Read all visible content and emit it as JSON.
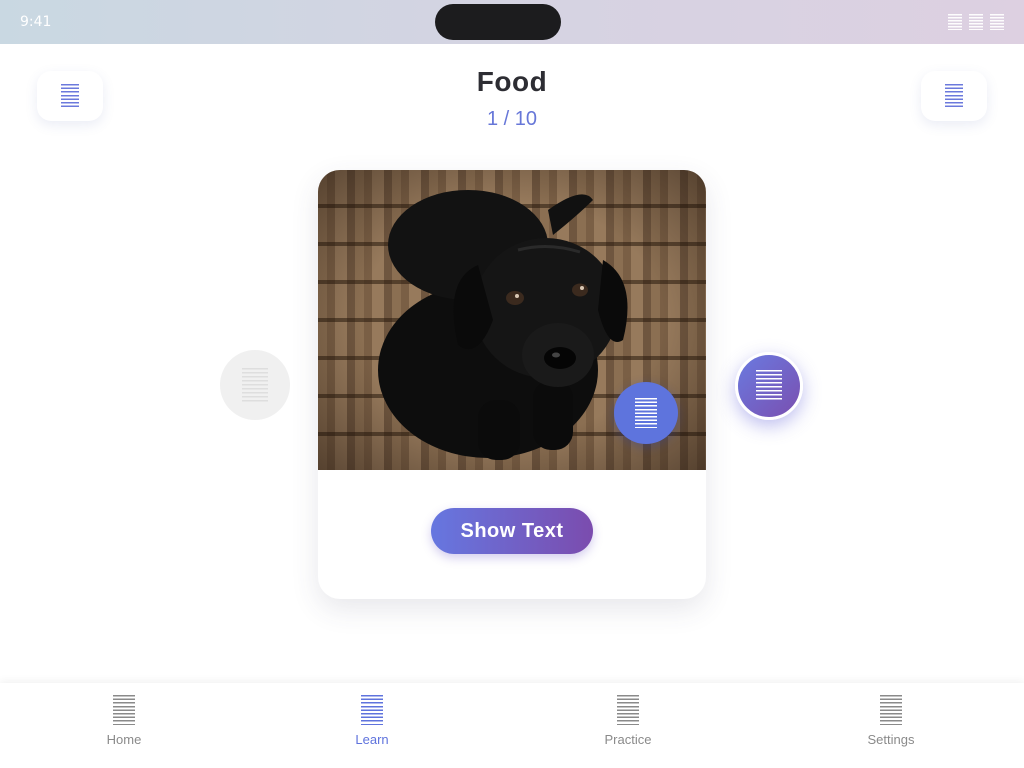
{
  "status_bar": {
    "time": "9:41"
  },
  "header": {
    "title": "Food",
    "counter": "1 / 10"
  },
  "card": {
    "show_text_label": "Show Text"
  },
  "tabs": [
    {
      "label": "Home",
      "active": false
    },
    {
      "label": "Learn",
      "active": true
    },
    {
      "label": "Practice",
      "active": false
    },
    {
      "label": "Settings",
      "active": false
    }
  ],
  "colors": {
    "accent": "#6777d8",
    "accent_purple": "#7b4cae",
    "text": "#2d2d33"
  }
}
